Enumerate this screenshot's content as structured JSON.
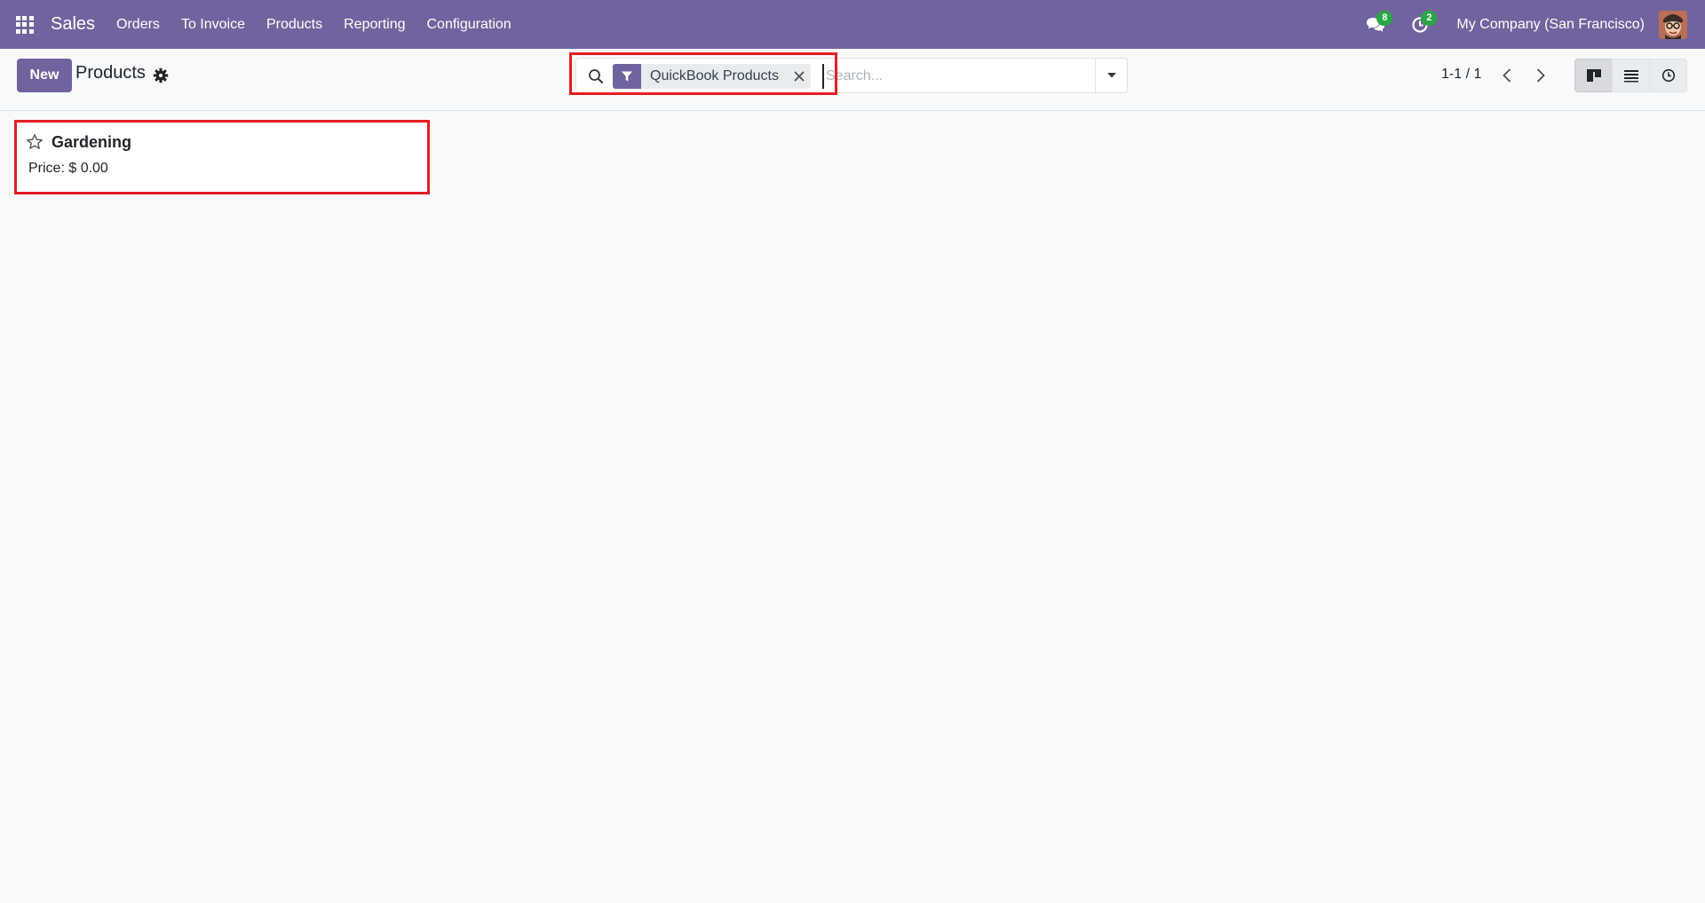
{
  "navbar": {
    "brand": "Sales",
    "menu": [
      "Orders",
      "To Invoice",
      "Products",
      "Reporting",
      "Configuration"
    ],
    "messages_badge": "8",
    "activities_badge": "2",
    "company": "My Company (San Francisco)"
  },
  "control_panel": {
    "new_label": "New",
    "title": "Products",
    "search": {
      "facet_label": "QuickBook Products",
      "placeholder": "Search..."
    },
    "pager": "1-1 / 1"
  },
  "kanban": {
    "records": [
      {
        "name": "Gardening",
        "price_label": "Price: $ 0.00"
      }
    ]
  },
  "colors": {
    "brand": "#71639e",
    "badge": "#28a745",
    "highlight": "#e51c23"
  }
}
